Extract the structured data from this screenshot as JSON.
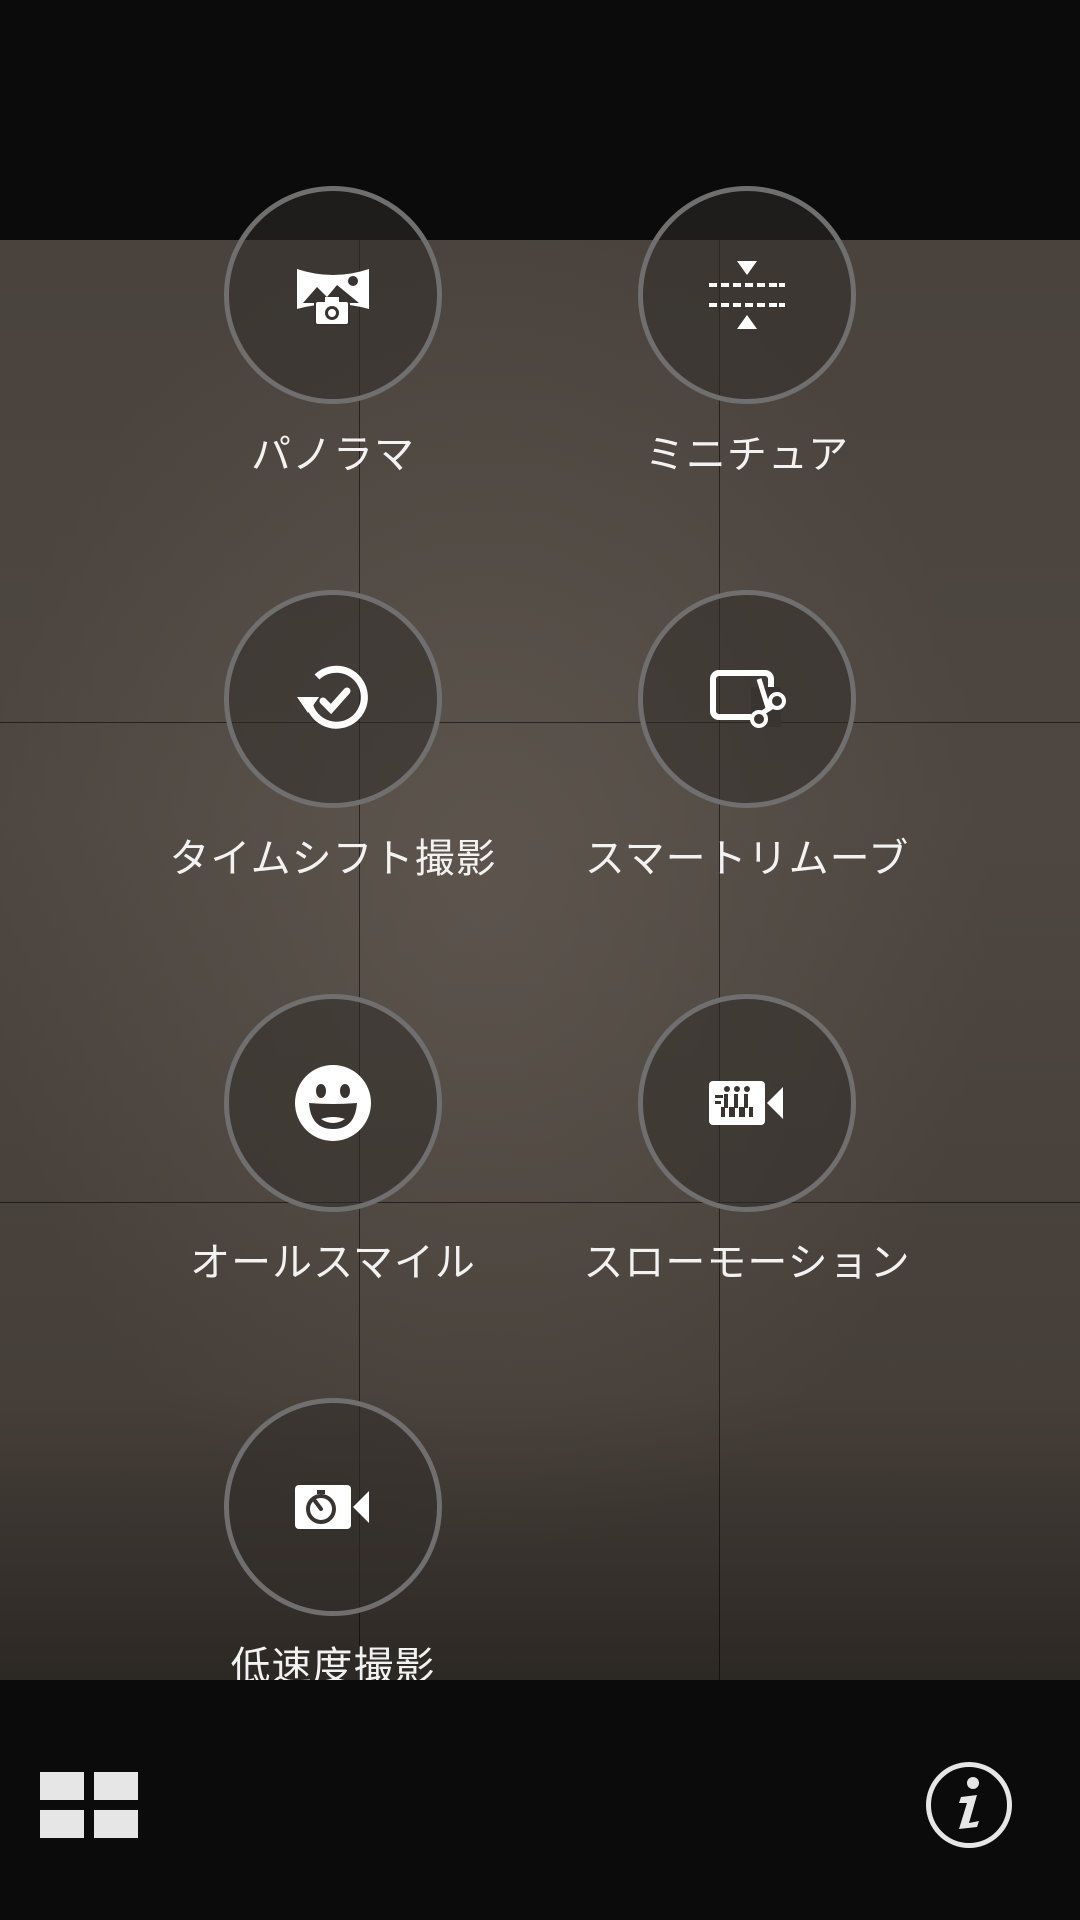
{
  "modes": [
    {
      "label": "パノラマ",
      "icon": "panorama-icon"
    },
    {
      "label": "ミニチュア",
      "icon": "miniature-icon"
    },
    {
      "label": "タイムシフト撮影",
      "icon": "timeshift-icon"
    },
    {
      "label": "スマートリムーブ",
      "icon": "smart-remove-icon"
    },
    {
      "label": "オールスマイル",
      "icon": "smile-icon"
    },
    {
      "label": "スローモーション",
      "icon": "slow-motion-icon"
    },
    {
      "label": "低速度撮影",
      "icon": "time-lapse-icon"
    }
  ],
  "bottom_bar": {
    "grid_icon": "grid-icon",
    "info_icon": "info-icon"
  },
  "colors": {
    "circle_border": "#6f6f6f",
    "label_text": "#f2f2f2",
    "icon_white": "#ffffff"
  }
}
